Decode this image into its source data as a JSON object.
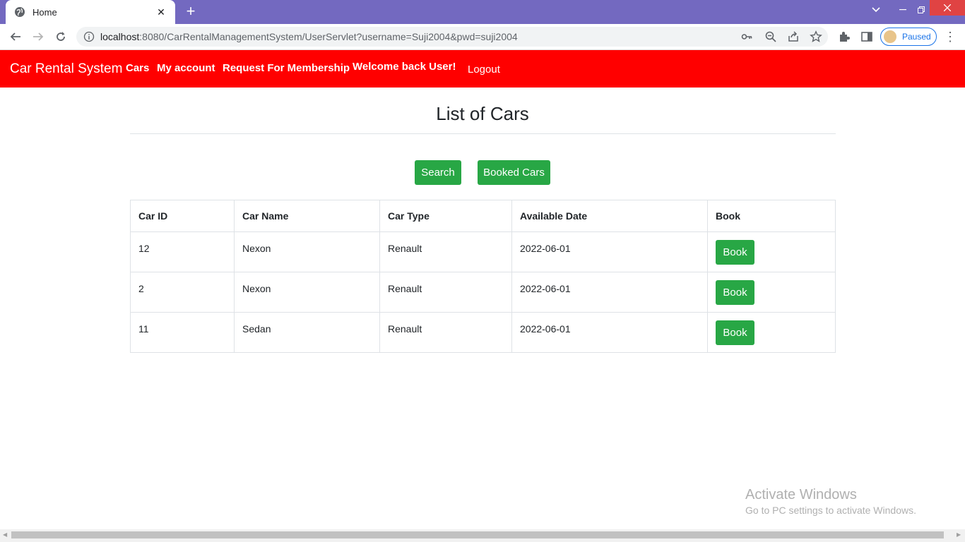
{
  "browser": {
    "tab_title": "Home",
    "url_host": "localhost",
    "url_rest": ":8080/CarRentalManagementSystem/UserServlet?username=Suji2004&pwd=suji2004",
    "profile_label": "Paused",
    "window_close_color": "#e04343",
    "tabbar_color": "#7369c0"
  },
  "navbar": {
    "brand": "Car Rental System",
    "links": [
      "Cars",
      "My account",
      "Request For Membership",
      "Welcome back User!"
    ],
    "logout": "Logout",
    "color": "#ff0000"
  },
  "main": {
    "title": "List of Cars",
    "search_button": "Search",
    "booked_button": "Booked Cars",
    "button_color": "#28a745"
  },
  "table": {
    "headers": [
      "Car ID",
      "Car Name",
      "Car Type",
      "Available Date",
      "Book"
    ],
    "rows": [
      {
        "id": "12",
        "name": "Nexon",
        "type": "Renault",
        "date": "2022-06-01",
        "action": "Book"
      },
      {
        "id": "2",
        "name": "Nexon",
        "type": "Renault",
        "date": "2022-06-01",
        "action": "Book"
      },
      {
        "id": "11",
        "name": "Sedan",
        "type": "Renault",
        "date": "2022-06-01",
        "action": "Book"
      }
    ]
  },
  "watermark": {
    "line1": "Activate Windows",
    "line2": "Go to PC settings to activate Windows."
  }
}
